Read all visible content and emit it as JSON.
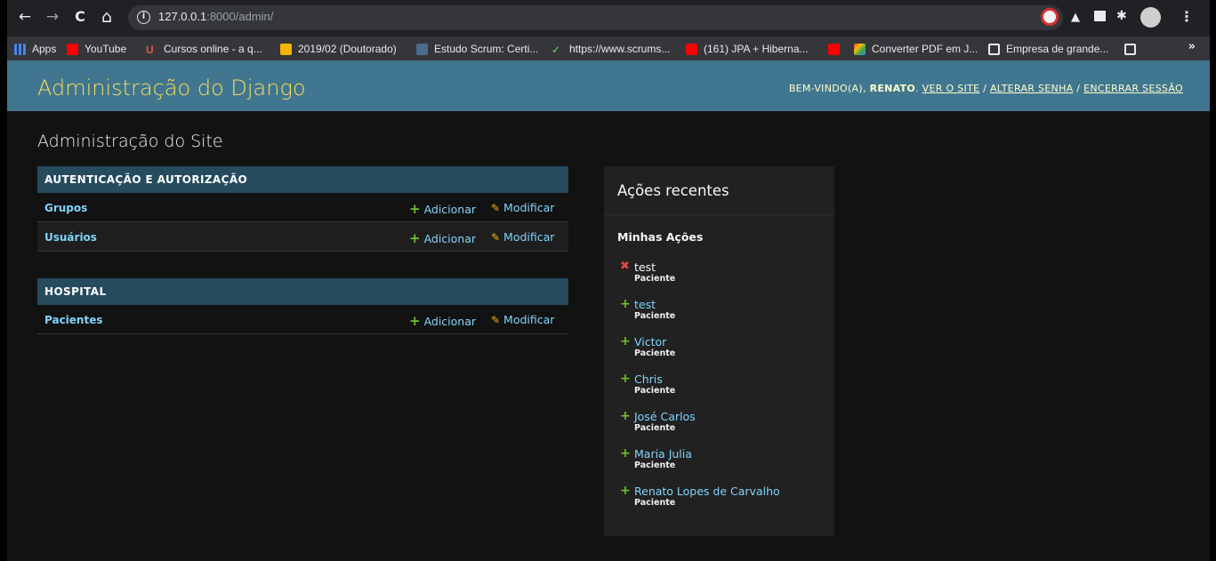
{
  "browser": {
    "nav": {
      "back": "←",
      "forward": "→",
      "reload": "C",
      "home": "⌂"
    },
    "url_host": "127.0.0.1",
    "url_rest": ":8000/admin/",
    "bookmarks": [
      {
        "label": "Apps",
        "icon": "apps-grid-icon"
      },
      {
        "label": "YouTube",
        "icon": "youtube-icon"
      },
      {
        "label": "Cursos online - a q...",
        "icon": "udemy-icon"
      },
      {
        "label": "2019/02 (Doutorado)",
        "icon": "play-icon"
      },
      {
        "label": "Estudo Scrum: Certi...",
        "icon": "scrum-icon"
      },
      {
        "label": "https://www.scrums...",
        "icon": "check-icon"
      },
      {
        "label": "(161) JPA + Hiberna...",
        "icon": "youtube-icon"
      },
      {
        "label": "",
        "icon": "youtube-icon"
      },
      {
        "label": "Converter PDF em J...",
        "icon": "converter-icon"
      },
      {
        "label": "Empresa de grande...",
        "icon": "globe-icon"
      },
      {
        "label": "",
        "icon": "globe-icon"
      }
    ],
    "more": "»"
  },
  "header": {
    "branding": "Administração do Django",
    "welcome": "Bem-vindo(a),",
    "username": "Renato",
    "view_site": "Ver o site",
    "change_password": "Alterar senha",
    "logout": "Encerrar sessão",
    "separator": "/"
  },
  "content_title": "Administração do Site",
  "apps": [
    {
      "caption": "Autenticação e Autorização",
      "models": [
        {
          "name": "Grupos",
          "add": "Adicionar",
          "change": "Modificar"
        },
        {
          "name": "Usuários",
          "add": "Adicionar",
          "change": "Modificar"
        }
      ]
    },
    {
      "caption": "Hospital",
      "models": [
        {
          "name": "Pacientes",
          "add": "Adicionar",
          "change": "Modificar"
        }
      ]
    }
  ],
  "recent_actions": {
    "title": "Ações recentes",
    "subtitle": "Minhas Ações",
    "items": [
      {
        "name": "test",
        "type": "Paciente",
        "action": "deleted"
      },
      {
        "name": "test",
        "type": "Paciente",
        "action": "added"
      },
      {
        "name": "Victor",
        "type": "Paciente",
        "action": "added"
      },
      {
        "name": "Chris",
        "type": "Paciente",
        "action": "added"
      },
      {
        "name": "José Carlos",
        "type": "Paciente",
        "action": "added"
      },
      {
        "name": "Maria Julia",
        "type": "Paciente",
        "action": "added"
      },
      {
        "name": "Renato Lopes de Carvalho",
        "type": "Paciente",
        "action": "added"
      }
    ]
  },
  "colors": {
    "header_bg": "#417690",
    "branding": "#f5dd5d",
    "caption_bg": "#264b5d",
    "link": "#81d4fa",
    "add_icon": "#70bf2b",
    "delete_icon": "#dd4646",
    "change_icon": "#efb80b"
  }
}
